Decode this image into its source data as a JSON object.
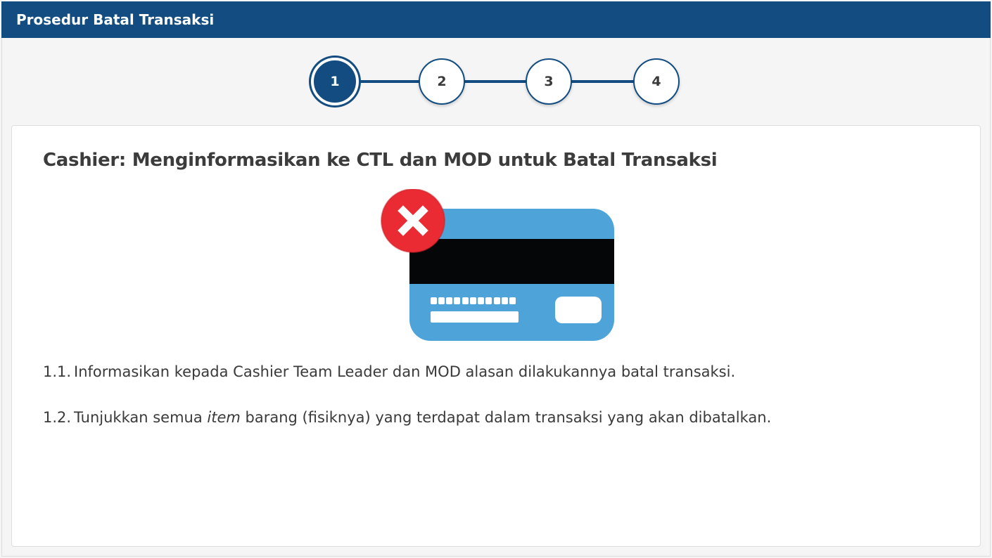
{
  "header": {
    "title": "Prosedur Batal Transaksi"
  },
  "stepper": {
    "steps": [
      "1",
      "2",
      "3",
      "4"
    ],
    "active": "1"
  },
  "content": {
    "title": "Cashier: Menginformasikan ke CTL dan MOD untuk Batal Transaksi",
    "illustration": "cancelled-credit-card-icon",
    "items": [
      {
        "number": "1.1.",
        "text": "Informasikan kepada Cashier Team Leader dan MOD alasan dilakukannya batal transaksi."
      },
      {
        "number": "1.2.",
        "text_before": "Tunjukkan semua ",
        "text_emphasis": "item",
        "text_after": " barang (fisiknya) yang terdapat dalam transaksi yang akan dibatalkan."
      }
    ]
  },
  "colors": {
    "brand": "#124c80",
    "card_blue": "#4ea3d8",
    "stripe": "#050608",
    "cancel_red": "#ea2b33"
  }
}
